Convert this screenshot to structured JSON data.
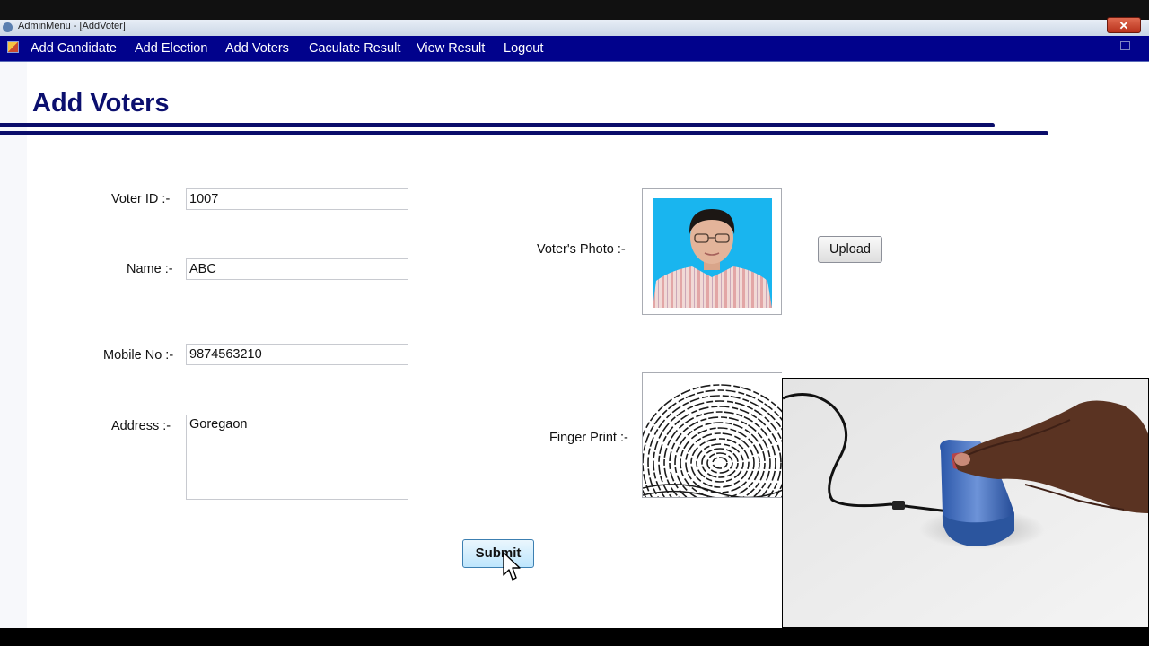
{
  "window": {
    "title": "AdminMenu - [AddVoter]",
    "close_glyph": "✕"
  },
  "menu": {
    "items": [
      {
        "label": "Add Candidate"
      },
      {
        "label": "Add Election"
      },
      {
        "label": "Add Voters"
      },
      {
        "label": "Caculate Result"
      },
      {
        "label": "View Result"
      },
      {
        "label": "Logout"
      }
    ]
  },
  "form": {
    "title": "Add Voters",
    "voter_id": {
      "label": "Voter ID  :-",
      "value": "1007"
    },
    "name": {
      "label": "Name  :-",
      "value": "ABC"
    },
    "mobile": {
      "label": "Mobile No  :-",
      "value": "9874563210"
    },
    "address": {
      "label": "Address  :-",
      "value": "Goregaon"
    },
    "photo": {
      "label": "Voter's Photo  :-"
    },
    "fingerprint": {
      "label": "Finger Print  :-"
    },
    "upload_label": "Upload",
    "submit_label": "Submit"
  },
  "colors": {
    "menubar": "#01028c",
    "heading": "#0b0f6e",
    "photo_background": "#19b5ef",
    "submit_button": "#bee6fd"
  },
  "icons": [
    "app-icon",
    "mdi-menu-icon",
    "close-icon",
    "restore-icon",
    "mouse-cursor-icon"
  ]
}
